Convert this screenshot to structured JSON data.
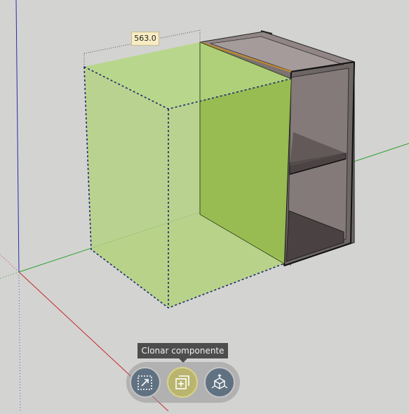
{
  "viewport": {
    "dimension_label": "563.0"
  },
  "tooltip": {
    "text": "Clonar componente"
  },
  "toolbar": {
    "buttons": [
      {
        "icon": "scale-arrow-icon"
      },
      {
        "icon": "clone-component-icon",
        "active": true
      },
      {
        "icon": "move-axes-icon"
      }
    ]
  },
  "colors": {
    "background": "#d3d3d2",
    "axis_red": "#c62a2a",
    "axis_green": "#2ea12e",
    "axis_blue": "#2b2bb0",
    "selection_fill": "#a7d45a",
    "cabinet_body": "#7d7373",
    "tooltip_bg": "#4d4d4d",
    "active_button": "#b9b56f",
    "button": "#607182"
  }
}
